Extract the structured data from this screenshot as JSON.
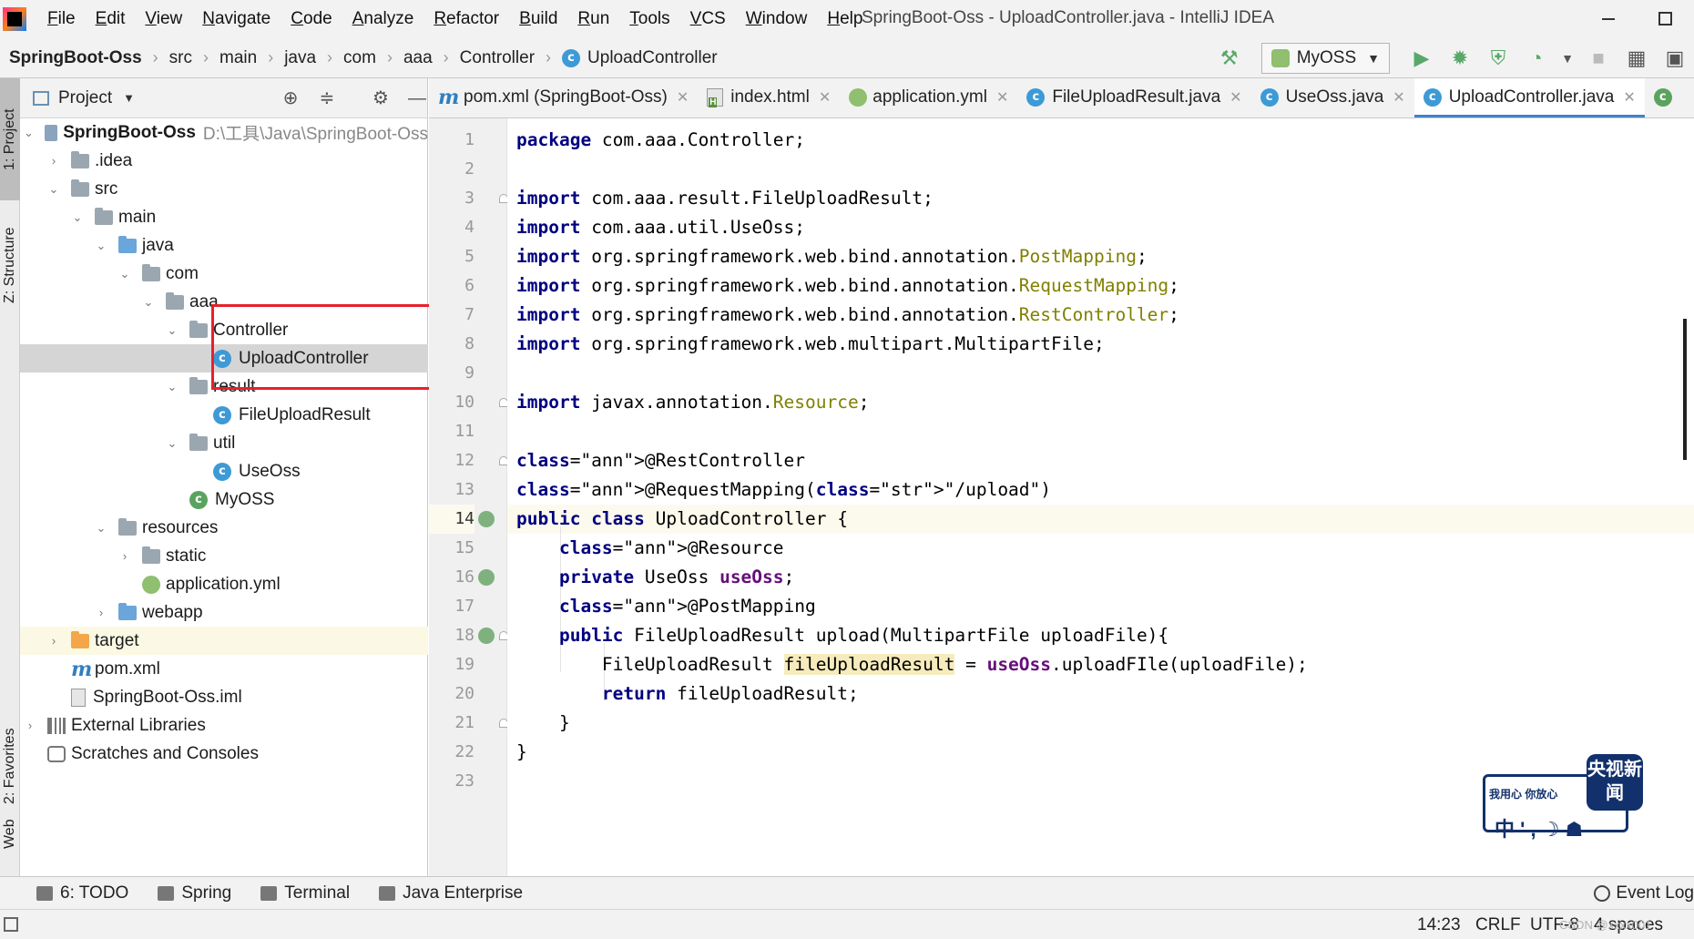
{
  "window": {
    "title": "SpringBoot-Oss - UploadController.java - IntelliJ IDEA"
  },
  "menu": [
    "File",
    "Edit",
    "View",
    "Navigate",
    "Code",
    "Analyze",
    "Refactor",
    "Build",
    "Run",
    "Tools",
    "VCS",
    "Window",
    "Help"
  ],
  "breadcrumb": [
    "SpringBoot-Oss",
    "src",
    "main",
    "java",
    "com",
    "aaa",
    "Controller",
    "UploadController"
  ],
  "run_config": "MyOSS",
  "left_strip": {
    "project": "1: Project",
    "structure": "Z: Structure",
    "favorites": "2: Favorites",
    "web": "Web"
  },
  "project_panel": {
    "title": "Project",
    "tree": [
      {
        "label": "SpringBoot-Oss",
        "hint": "D:\\工具\\Java\\SpringBoot-Oss"
      },
      {
        "label": ".idea"
      },
      {
        "label": "src"
      },
      {
        "label": "main"
      },
      {
        "label": "java"
      },
      {
        "label": "com"
      },
      {
        "label": "aaa"
      },
      {
        "label": "Controller"
      },
      {
        "label": "UploadController"
      },
      {
        "label": "result"
      },
      {
        "label": "FileUploadResult"
      },
      {
        "label": "util"
      },
      {
        "label": "UseOss"
      },
      {
        "label": "MyOSS"
      },
      {
        "label": "resources"
      },
      {
        "label": "static"
      },
      {
        "label": "application.yml"
      },
      {
        "label": "webapp"
      },
      {
        "label": "target"
      },
      {
        "label": "pom.xml"
      },
      {
        "label": "SpringBoot-Oss.iml"
      },
      {
        "label": "External Libraries"
      },
      {
        "label": "Scratches and Consoles"
      }
    ]
  },
  "editor_tabs": [
    {
      "label": "pom.xml (SpringBoot-Oss)"
    },
    {
      "label": "index.html"
    },
    {
      "label": "application.yml"
    },
    {
      "label": "FileUploadResult.java"
    },
    {
      "label": "UseOss.java"
    },
    {
      "label": "UploadController.java"
    }
  ],
  "code": {
    "current_line": 14,
    "lines": [
      "package com.aaa.Controller;",
      "",
      "import com.aaa.result.FileUploadResult;",
      "import com.aaa.util.UseOss;",
      "import org.springframework.web.bind.annotation.PostMapping;",
      "import org.springframework.web.bind.annotation.RequestMapping;",
      "import org.springframework.web.bind.annotation.RestController;",
      "import org.springframework.web.multipart.MultipartFile;",
      "",
      "import javax.annotation.Resource;",
      "",
      "@RestController",
      "@RequestMapping(\"/upload\")",
      "public class UploadController {",
      "    @Resource",
      "    private UseOss useOss;",
      "    @PostMapping",
      "    public FileUploadResult upload(MultipartFile uploadFile){",
      "        FileUploadResult fileUploadResult = useOss.uploadFIle(uploadFile);",
      "        return fileUploadResult;",
      "    }",
      "}",
      ""
    ]
  },
  "watermark": {
    "slogan": "我用心 你放心",
    "badge": "央视新闻",
    "glyphs": "中 ' , ☽ ☗"
  },
  "bottom_tools": [
    "6: TODO",
    "Spring",
    "Terminal",
    "Java Enterprise"
  ],
  "event_log": "Event Log",
  "status": {
    "position": "14:23",
    "line_sep": "CRLF",
    "encoding": "UTF-8",
    "indent": "4 spaces",
    "csdn": "CSDN @xxxx001"
  },
  "colors": {
    "keyword": "#000080",
    "annotation": "#808000",
    "string": "#008000",
    "field": "#660e7a",
    "highlight_box": "#e8202a",
    "active_tab": "#4083c9"
  }
}
